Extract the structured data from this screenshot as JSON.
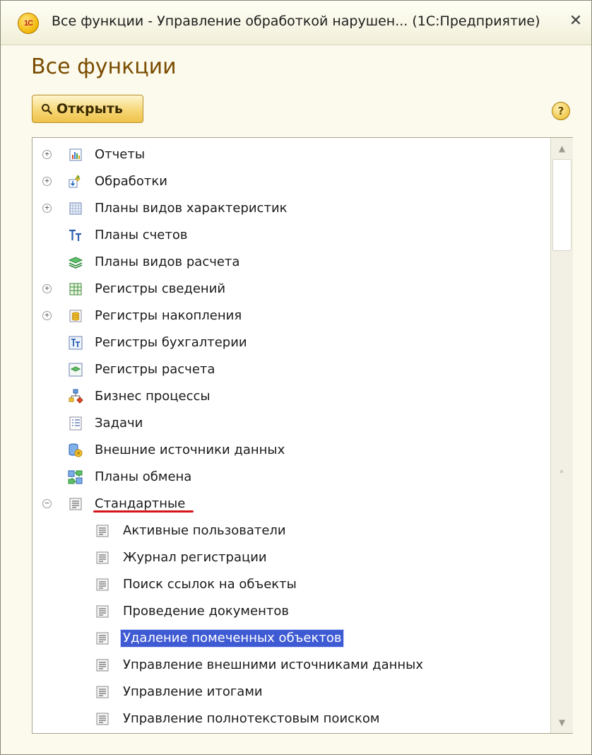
{
  "window": {
    "title": "Все функции - Управление обработкой нарушен... (1С:Предприятие)",
    "logo_text": "1С",
    "close_label": "✕"
  },
  "page": {
    "heading": "Все функции",
    "open_button_label": "Открыть",
    "help_label": "?"
  },
  "tree": {
    "items": [
      {
        "label": "Отчеты",
        "icon": "report-icon",
        "expander": "+"
      },
      {
        "label": "Обработки",
        "icon": "data-processor-icon",
        "expander": "+"
      },
      {
        "label": "Планы видов характеристик",
        "icon": "characteristic-types-icon",
        "expander": "+"
      },
      {
        "label": "Планы счетов",
        "icon": "chart-of-accounts-icon",
        "expander": ""
      },
      {
        "label": "Планы видов расчета",
        "icon": "calculation-types-icon",
        "expander": ""
      },
      {
        "label": "Регистры сведений",
        "icon": "information-register-icon",
        "expander": "+"
      },
      {
        "label": "Регистры накопления",
        "icon": "accumulation-register-icon",
        "expander": "+"
      },
      {
        "label": "Регистры бухгалтерии",
        "icon": "accounting-register-icon",
        "expander": ""
      },
      {
        "label": "Регистры расчета",
        "icon": "calculation-register-icon",
        "expander": ""
      },
      {
        "label": "Бизнес процессы",
        "icon": "business-process-icon",
        "expander": ""
      },
      {
        "label": "Задачи",
        "icon": "task-icon",
        "expander": ""
      },
      {
        "label": "Внешние источники данных",
        "icon": "external-data-source-icon",
        "expander": ""
      },
      {
        "label": "Планы обмена",
        "icon": "exchange-plan-icon",
        "expander": ""
      },
      {
        "label": "Стандартные",
        "icon": "standard-group-icon",
        "expander": "−"
      }
    ],
    "children": [
      {
        "label": "Активные пользователи",
        "icon": "form-icon"
      },
      {
        "label": "Журнал регистрации",
        "icon": "form-icon"
      },
      {
        "label": "Поиск ссылок на объекты",
        "icon": "form-icon"
      },
      {
        "label": "Проведение документов",
        "icon": "form-icon"
      },
      {
        "label": "Удаление помеченных объектов",
        "icon": "form-icon",
        "selected": true
      },
      {
        "label": "Управление внешними источниками данных",
        "icon": "form-icon"
      },
      {
        "label": "Управление итогами",
        "icon": "form-icon"
      },
      {
        "label": "Управление полнотекстовым поиском",
        "icon": "form-icon"
      }
    ]
  },
  "scrollbar": {
    "up_label": "▲",
    "down_label": "▼"
  },
  "colors": {
    "heading": "#7a4c00",
    "selection": "#3f5bd4",
    "underline": "#d6141a",
    "window_bg": "#fbfaec"
  }
}
